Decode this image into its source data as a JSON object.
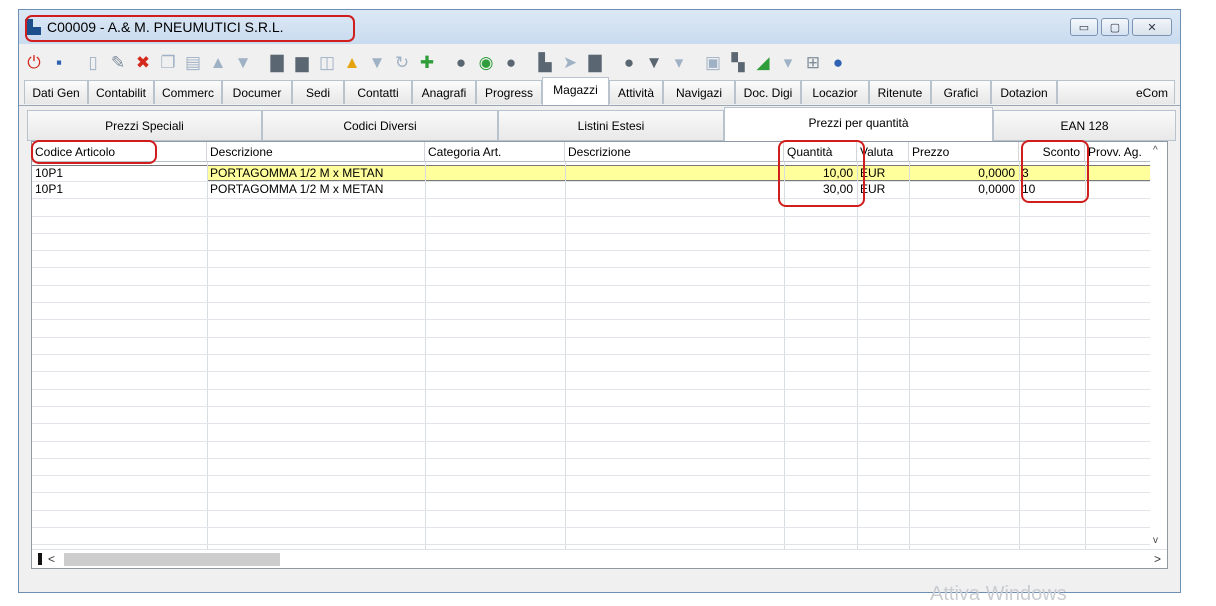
{
  "window": {
    "title": "C00009 - A.& M. PNEUMUTICI S.R.L.",
    "buttons": {
      "minimize": "▭",
      "maximize": "▢",
      "close": "✕"
    }
  },
  "toolbar_icons": [
    "power-icon",
    "save-icon",
    "document-icon",
    "edit-pencil-icon",
    "delete-icon",
    "copy-icon",
    "paste-icon",
    "arrow-up-icon",
    "arrow-down-icon",
    "stack-icon",
    "print-icon",
    "code-icon",
    "warning-icon",
    "filter-icon",
    "refresh-icon",
    "tools-icon",
    "circle-icon",
    "green-circle-icon",
    "circle-icon",
    "book-icon",
    "forward-icon",
    "bookmark-icon",
    "circle-icon",
    "filter-dropdown-icon",
    "clipboard-icon",
    "stack-icon",
    "chart-icon",
    "network-icon",
    "globe-icon"
  ],
  "main_tabs": [
    {
      "label": "Dati Gen"
    },
    {
      "label": "Contabilit"
    },
    {
      "label": "Commerc"
    },
    {
      "label": "Documer"
    },
    {
      "label": "Sedi"
    },
    {
      "label": "Contatti"
    },
    {
      "label": "Anagrafi"
    },
    {
      "label": "Progress"
    },
    {
      "label": "Magazzi"
    },
    {
      "label": "Attività"
    },
    {
      "label": "Navigazi"
    },
    {
      "label": "Doc. Digi"
    },
    {
      "label": "Locazior"
    },
    {
      "label": "Ritenute"
    },
    {
      "label": "Grafici"
    },
    {
      "label": "Dotazion"
    },
    {
      "label": "eCom"
    }
  ],
  "sub_tabs": [
    {
      "label": "Prezzi Speciali"
    },
    {
      "label": "Codici Diversi"
    },
    {
      "label": "Listini Estesi"
    },
    {
      "label": "Prezzi per quantità"
    },
    {
      "label": "EAN 128"
    }
  ],
  "table": {
    "columns": [
      "Codice Articolo",
      "Descrizione",
      "Categoria Art.",
      "Descrizione",
      "Quantità",
      "Valuta",
      "Prezzo",
      "Sconto",
      "Provv. Ag."
    ],
    "rows": [
      [
        "10P1",
        "PORTAGOMMA 1/2 M x METAN",
        "",
        "",
        "10,00",
        "EUR",
        "0,0000",
        "3",
        ""
      ],
      [
        "10P1",
        "PORTAGOMMA 1/2 M x METAN",
        "",
        "",
        "30,00",
        "EUR",
        "0,0000",
        "10",
        ""
      ]
    ]
  },
  "scroll": {
    "up": "^",
    "down": "v",
    "left": "<",
    "right": ">"
  },
  "watermark": "Attiva Windows"
}
